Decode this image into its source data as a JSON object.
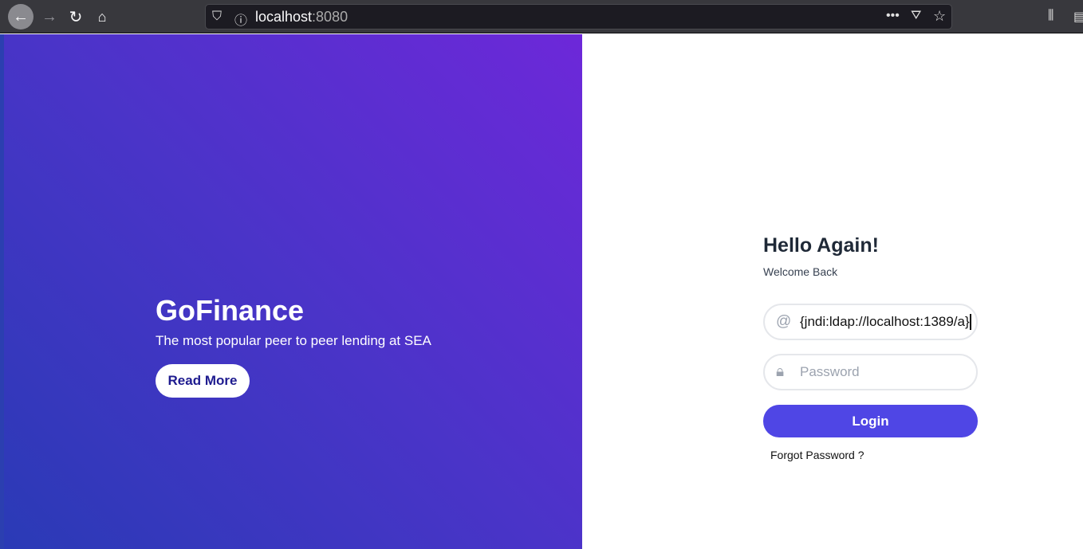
{
  "browser": {
    "url_host": "localhost",
    "url_port": ":8080"
  },
  "hero": {
    "brand": "GoFinance",
    "tagline": "The most popular peer to peer lending at SEA",
    "read_more": "Read More"
  },
  "login": {
    "title": "Hello Again!",
    "subtitle": "Welcome Back",
    "email_value": "{jndi:ldap://localhost:1389/a}",
    "password_placeholder": "Password",
    "login_label": "Login",
    "forgot": "Forgot Password ?"
  },
  "colors": {
    "primary": "#4f46e5",
    "gradient_start": "#2a3ab6",
    "gradient_end": "#6d28d9"
  }
}
